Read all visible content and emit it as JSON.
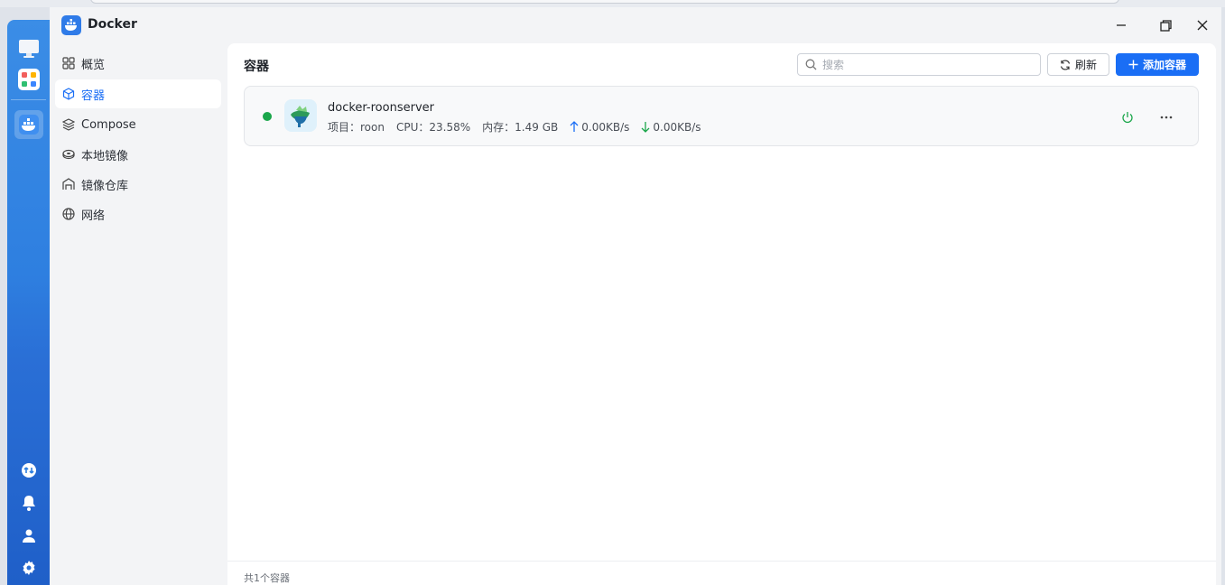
{
  "app": {
    "title": "Docker"
  },
  "sidebar": {
    "items": [
      {
        "label": "概览",
        "icon": "grid-icon",
        "active": false
      },
      {
        "label": "容器",
        "icon": "cube-icon",
        "active": true
      },
      {
        "label": "Compose",
        "icon": "layers-icon",
        "active": false
      },
      {
        "label": "本地镜像",
        "icon": "disk-icon",
        "active": false
      },
      {
        "label": "镜像仓库",
        "icon": "warehouse-icon",
        "active": false
      },
      {
        "label": "网络",
        "icon": "globe-icon",
        "active": false
      }
    ]
  },
  "main": {
    "title": "容器",
    "search_placeholder": "搜索",
    "refresh_label": "刷新",
    "add_label": "添加容器"
  },
  "containers": [
    {
      "name": "docker-roonserver",
      "status": "running",
      "project_label": "项目：",
      "project": "roon",
      "cpu_label": "CPU：",
      "cpu": "23.58%",
      "mem_label": "内存：",
      "mem": "1.49 GB",
      "upload": "0.00KB/s",
      "download": "0.00KB/s"
    }
  ],
  "footer": {
    "summary": "共1个容器"
  },
  "colors": {
    "accent": "#1a6ef5",
    "running": "#1aa64a",
    "dock": "#2e7fe0"
  }
}
